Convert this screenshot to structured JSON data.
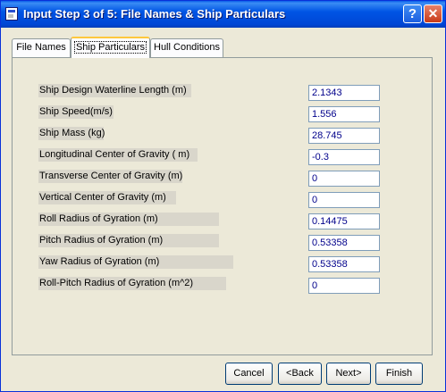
{
  "window": {
    "title": "Input Step 3 of 5: File Names & Ship Particulars",
    "help_label": "?",
    "close_label": "✕"
  },
  "tabs": [
    {
      "label": "File Names"
    },
    {
      "label": "Ship Particulars"
    },
    {
      "label": "Hull Conditions"
    }
  ],
  "fields": [
    {
      "label": "Ship Design Waterline Length (m)",
      "value": "2.1343"
    },
    {
      "label": "Ship Speed(m/s)",
      "value": "1.556"
    },
    {
      "label": "Ship Mass (kg)",
      "value": "28.745"
    },
    {
      "label": "Longitudinal Center of Gravity ( m)",
      "value": "-0.3"
    },
    {
      "label": "Transverse Center of Gravity (m)",
      "value": "0"
    },
    {
      "label": "Vertical Center of Gravity (m)",
      "value": "0"
    },
    {
      "label": "Roll Radius of Gyration (m)",
      "value": "0.14475"
    },
    {
      "label": "Pitch Radius of Gyration (m)",
      "value": "0.53358"
    },
    {
      "label": "Yaw Radius of Gyration (m)",
      "value": "0.53358"
    },
    {
      "label": "Roll-Pitch Radius of Gyration (m^2)",
      "value": "0"
    }
  ],
  "buttons": {
    "cancel": "Cancel",
    "back": "<Back",
    "next": "Next>",
    "finish": "Finish"
  }
}
